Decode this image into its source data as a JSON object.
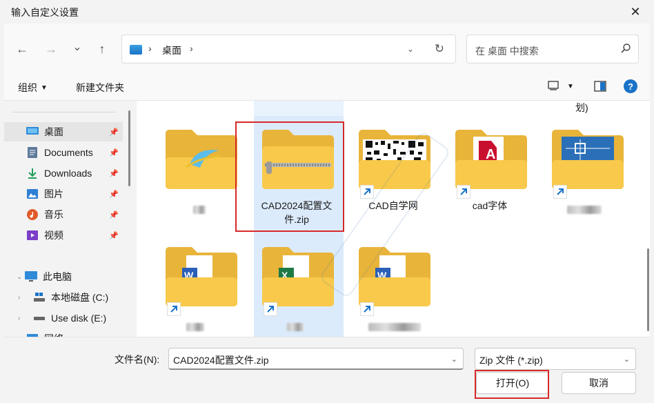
{
  "window": {
    "title": "输入自定义设置",
    "close_glyph": "✕"
  },
  "nav": {
    "back_glyph": "←",
    "forward_glyph": "→",
    "recent_glyph": "⌄",
    "up_glyph": "↑",
    "breadcrumb": [
      "桌面"
    ],
    "breadcrumb_sep": "›",
    "refresh_glyph": "↻",
    "dropdown_glyph": "⌄",
    "search_placeholder": "在 桌面 中搜索"
  },
  "toolbar": {
    "organize": "组织",
    "new_folder": "新建文件夹",
    "help": "?"
  },
  "sidebar": {
    "items": [
      {
        "label": "桌面",
        "icon": "desktop-icon",
        "pinned": true,
        "selected": true
      },
      {
        "label": "Documents",
        "icon": "documents-icon",
        "pinned": true
      },
      {
        "label": "Downloads",
        "icon": "downloads-icon",
        "pinned": true
      },
      {
        "label": "图片",
        "icon": "pictures-icon",
        "pinned": true
      },
      {
        "label": "音乐",
        "icon": "music-icon",
        "pinned": true
      },
      {
        "label": "视频",
        "icon": "videos-icon",
        "pinned": true
      }
    ],
    "tree": [
      {
        "label": "此电脑",
        "icon": "this-pc-icon"
      },
      {
        "label": "本地磁盘 (C:)",
        "icon": "drive-icon"
      },
      {
        "label": "Use disk (E:)",
        "icon": "usb-drive-icon"
      },
      {
        "label": "网络",
        "icon": "network-icon"
      }
    ]
  },
  "content": {
    "top_partial_label": "划)",
    "items": [
      {
        "label": "",
        "type": "folder-ie",
        "shortcut": false
      },
      {
        "label": "CAD2024配置文件.zip",
        "type": "zip",
        "shortcut": false,
        "selected": true
      },
      {
        "label": "CAD自学网",
        "type": "folder-qr",
        "shortcut": true
      },
      {
        "label": "cad字体",
        "type": "folder-autocad",
        "shortcut": true
      },
      {
        "label": "",
        "type": "folder-blueprint",
        "shortcut": true
      },
      {
        "label": "",
        "type": "folder-word",
        "shortcut": true
      },
      {
        "label": "",
        "type": "folder-excel",
        "shortcut": true
      },
      {
        "label": "",
        "type": "folder-word",
        "shortcut": true
      }
    ]
  },
  "bottom": {
    "filename_label": "文件名(N):",
    "filename_value": "CAD2024配置文件.zip",
    "filetype_value": "Zip 文件 (*.zip)",
    "open_button": "打开(O)",
    "cancel_button": "取消"
  },
  "colors": {
    "accent": "#1a73c8",
    "highlight": "#d62828",
    "folder_yellow": "#f8c94a"
  }
}
